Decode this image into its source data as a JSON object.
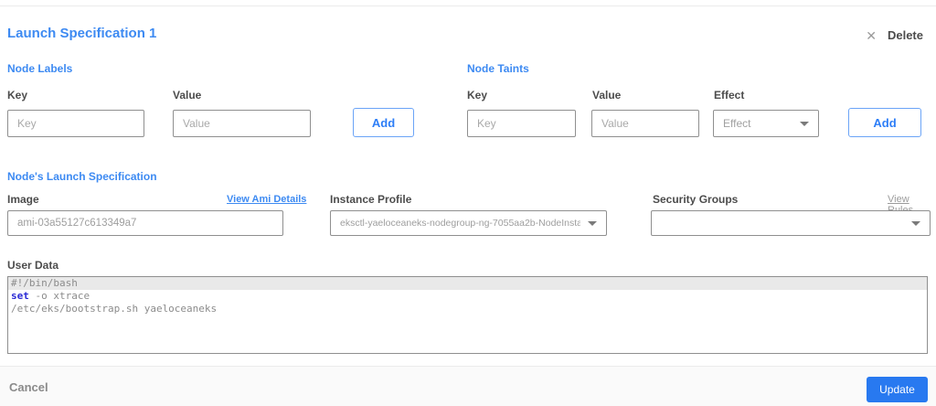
{
  "icons": {
    "delete_x": "✕"
  },
  "header": {
    "title": "Launch Specification 1",
    "delete_label": "Delete"
  },
  "node_labels": {
    "heading": "Node Labels",
    "key_label": "Key",
    "key_placeholder": "Key",
    "value_label": "Value",
    "value_placeholder": "Value",
    "add_label": "Add"
  },
  "node_taints": {
    "heading": "Node Taints",
    "key_label": "Key",
    "key_placeholder": "Key",
    "value_label": "Value",
    "value_placeholder": "Value",
    "effect_label": "Effect",
    "effect_placeholder": "Effect",
    "add_label": "Add"
  },
  "launch_spec": {
    "heading": "Node's Launch Specification",
    "image_label": "Image",
    "view_ami_link": "View Ami Details",
    "image_value": "ami-03a55127c613349a7",
    "instance_profile_label": "Instance Profile",
    "instance_profile_value": "eksctl-yaeloceaneks-nodegroup-ng-7055aa2b-NodeInstanceProfile-...",
    "security_groups_label": "Security Groups",
    "view_rules_link": "View Rules"
  },
  "user_data": {
    "label": "User Data",
    "line1": "#!/bin/bash",
    "line2_keyword": "set",
    "line2_rest": " -o xtrace",
    "line3": "/etc/eks/bootstrap.sh yaeloceaneks"
  },
  "footer": {
    "cancel_label": "Cancel",
    "update_label": "Update"
  },
  "colors": {
    "accent_blue": "#3d8af2",
    "button_blue": "#2879f0",
    "text_dark": "#4c4c4c",
    "link_gray": "#9b9b9b",
    "code_keyword_blue": "#2b2bd5"
  }
}
